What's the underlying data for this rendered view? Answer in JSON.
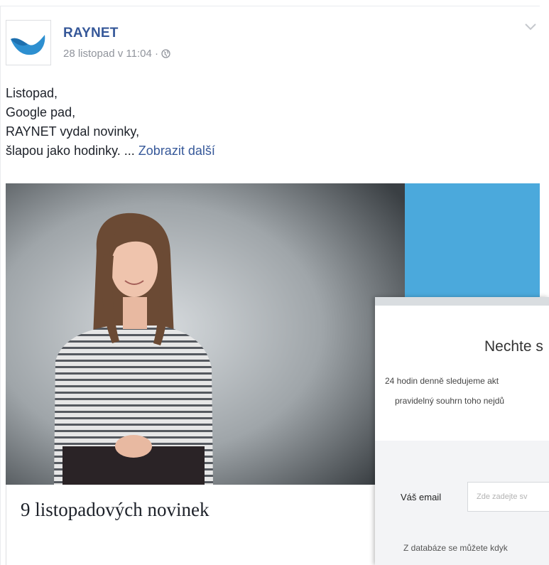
{
  "post": {
    "page_name": "RAYNET",
    "timestamp": "28 listopad v 11:04 ·",
    "lines": [
      "Listopad,",
      "Google pad,",
      "RAYNET vydal novinky,",
      "šlapou jako hodinky. ..."
    ],
    "see_more": "Zobrazit další",
    "link_title": "9 listopadových novinek"
  },
  "modal": {
    "title": "Nechte s",
    "desc_line1": "24 hodin denně sledujeme akt",
    "desc_line2": "pravidelný souhrn toho nejdů",
    "email_label": "Váš email",
    "email_placeholder": "Zde zadejte sv",
    "db_note": "Z databáze se můžete kdyk"
  },
  "colors": {
    "link": "#365899",
    "brand_blue": "#4ba9dc",
    "muted": "#90949c"
  },
  "icons": {
    "avatar": "raynet-bird-logo",
    "privacy": "globe-icon",
    "options": "chevron-down-icon"
  }
}
